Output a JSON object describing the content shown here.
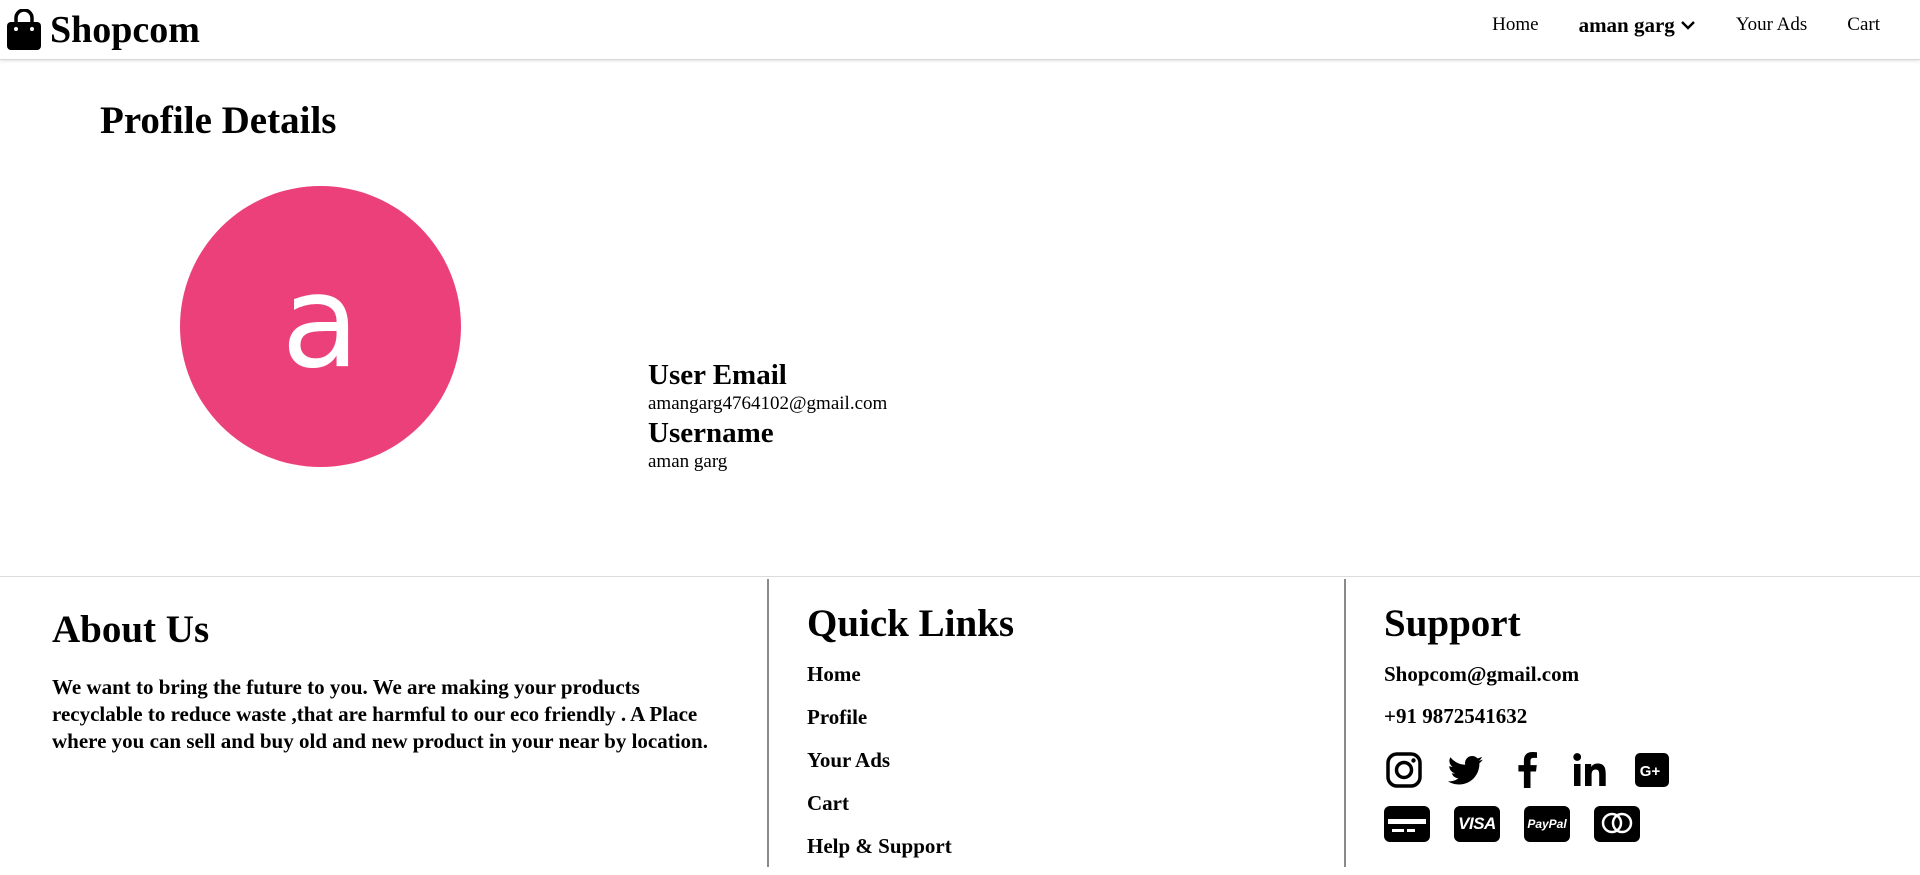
{
  "header": {
    "brand": "Shopcom",
    "nav": {
      "home": "Home",
      "user": "aman garg",
      "your_ads": "Your Ads",
      "cart": "Cart"
    }
  },
  "profile": {
    "title": "Profile Details",
    "avatar_letter": "a",
    "avatar_color": "#ec407a",
    "email_label": "User Email",
    "email_value": "amangarg4764102@gmail.com",
    "username_label": "Username",
    "username_value": "aman garg"
  },
  "footer": {
    "about": {
      "title": "About Us",
      "text": "We want to bring the future to you. We are making your products recyclable to reduce waste ,that are harmful to our eco friendly . A Place where you can sell and buy old and new product in your near by location."
    },
    "quick_links": {
      "title": "Quick Links",
      "items": [
        {
          "label": "Home"
        },
        {
          "label": "Profile"
        },
        {
          "label": "Your Ads"
        },
        {
          "label": "Cart"
        },
        {
          "label": "Help & Support"
        }
      ]
    },
    "support": {
      "title": "Support",
      "email": "Shopcom@gmail.com",
      "phone": "+91 9872541632",
      "social_icons": [
        "instagram-icon",
        "twitter-icon",
        "facebook-icon",
        "linkedin-icon",
        "google-plus-icon"
      ],
      "payment_icons": [
        "credit-card-icon",
        "visa-icon",
        "paypal-icon",
        "mastercard-icon"
      ],
      "visa_text": "VISA",
      "paypal_text": "PayPal"
    }
  }
}
